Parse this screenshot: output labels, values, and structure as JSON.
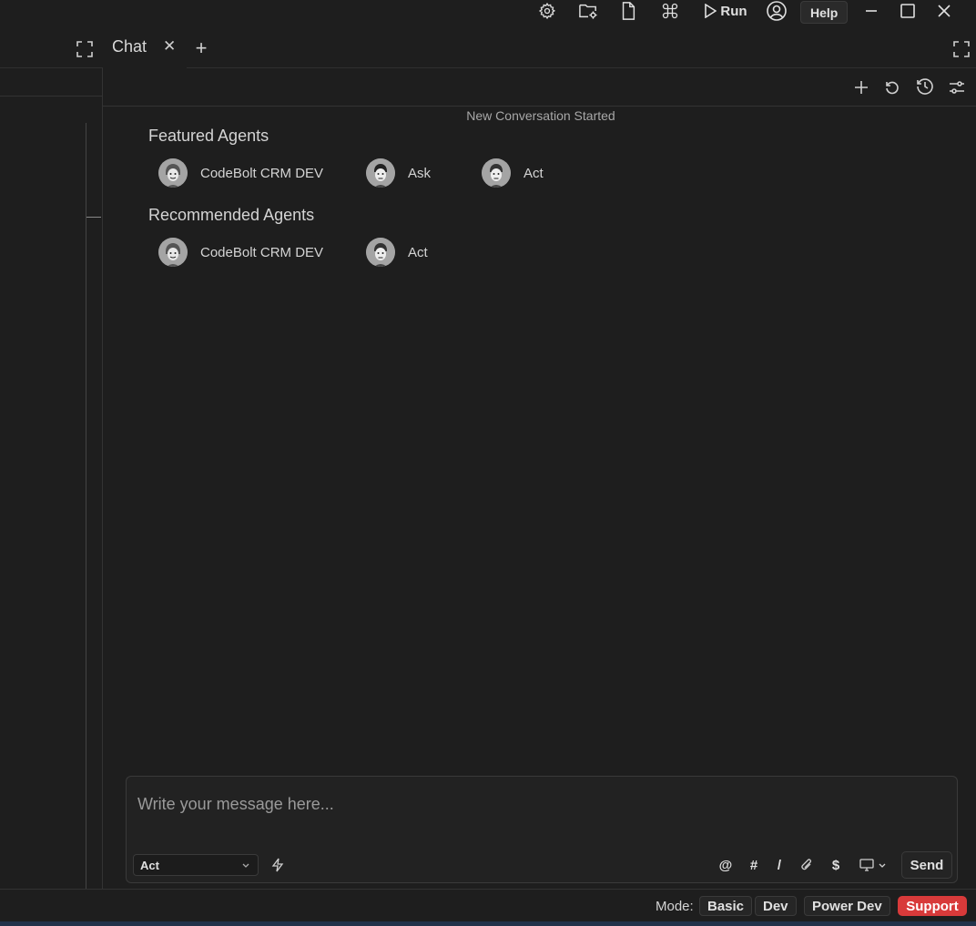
{
  "titlebar": {
    "run_label": "Run",
    "help_label": "Help",
    "icons": [
      "gear-icon",
      "folder-settings-icon",
      "file-icon",
      "command-icon",
      "play-icon",
      "user-circle-icon",
      "minimize-icon",
      "maximize-icon",
      "close-icon"
    ]
  },
  "tabs": {
    "chat_label": "Chat",
    "close_symbol": "✕",
    "add_symbol": "+"
  },
  "chat": {
    "conversation_status": "New Conversation Started",
    "featured_title": "Featured Agents",
    "featured_agents": [
      {
        "name": "CodeBolt CRM DEV"
      },
      {
        "name": "Ask"
      },
      {
        "name": "Act"
      }
    ],
    "recommended_title": "Recommended Agents",
    "recommended_agents": [
      {
        "name": "CodeBolt CRM DEV"
      },
      {
        "name": "Act"
      }
    ]
  },
  "composer": {
    "placeholder": "Write your message here...",
    "value": "",
    "agent_select": "Act",
    "tools": [
      "@",
      "#",
      "/"
    ],
    "dollar": "$",
    "send_label": "Send"
  },
  "status": {
    "mode_label": "Mode:",
    "modes": [
      "Basic",
      "Dev",
      "Power Dev"
    ],
    "support_label": "Support"
  },
  "colors": {
    "background": "#1e1e1e",
    "support": "#d83a3a"
  }
}
